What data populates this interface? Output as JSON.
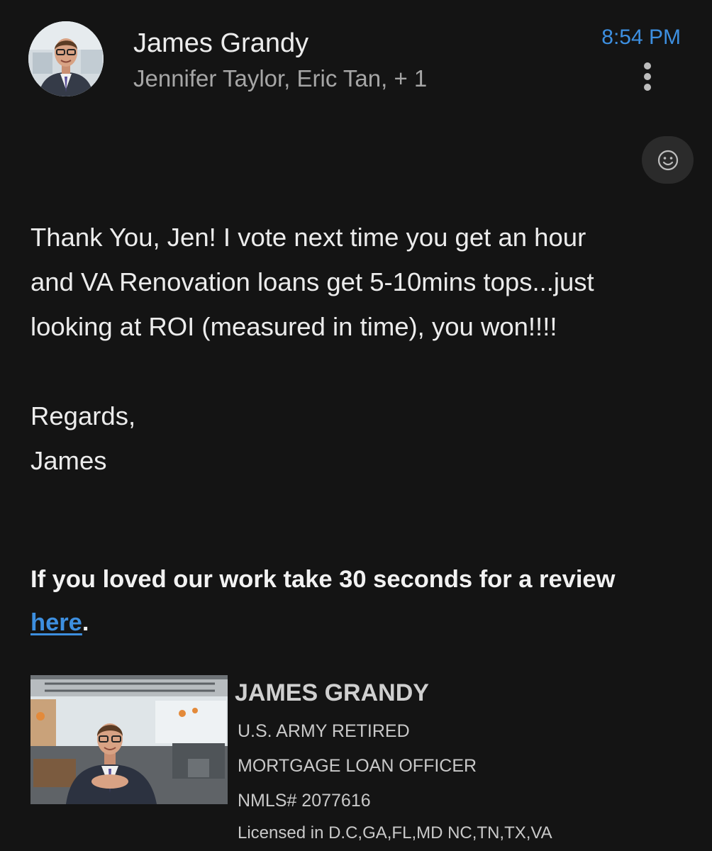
{
  "header": {
    "sender_name": "James Grandy",
    "recipients": "Jennifer Taylor, Eric Tan, + 1",
    "time": "8:54 PM",
    "avatar_icon": "person-photo",
    "more_icon": "more-vertical-icon",
    "emoji_icon": "smiley-add-reaction-icon"
  },
  "message": {
    "lines": [
      "Thank You, Jen!  I vote next time you get an hour",
      "and VA Renovation loans get 5-10mins tops...just",
      "looking at ROI (measured in time), you won!!!!"
    ],
    "closing": "Regards,",
    "signoff": "James"
  },
  "review": {
    "text": "If you loved our work take 30 seconds for a review",
    "link_text": "here",
    "suffix": "."
  },
  "signature": {
    "name": "JAMES GRANDY",
    "line1": "U.S. ARMY RETIRED",
    "line2": "MORTGAGE LOAN OFFICER",
    "line3": "NMLS# 2077616",
    "line4": "Licensed in D.C,GA,FL,MD NC,TN,TX,VA"
  },
  "colors": {
    "background": "#141414",
    "accent": "#3d8fe0",
    "primary_text": "#ececec",
    "secondary_text": "#a6a6a6"
  }
}
